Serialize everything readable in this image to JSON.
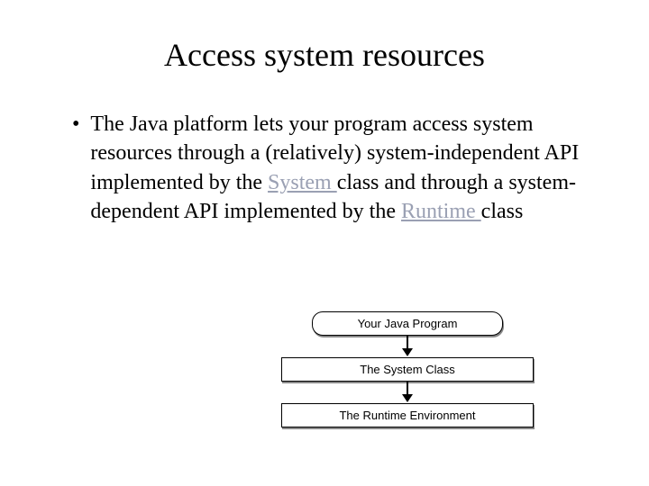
{
  "title": "Access system resources",
  "bullet": {
    "part1": "The Java platform lets your program access system resources through a (relatively) system-independent API implemented by the ",
    "link1": "System ",
    "part2": " class and through a system-dependent API implemented by the ",
    "link2": "Runtime ",
    "part3": " class"
  },
  "diagram": {
    "box1": "Your Java Program",
    "box2": "The System Class",
    "box3": "The Runtime Environment"
  }
}
